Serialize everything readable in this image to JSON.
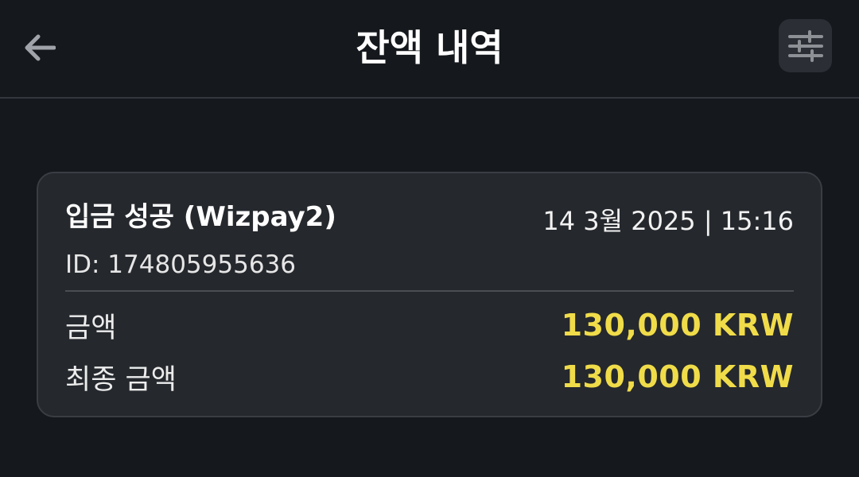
{
  "header": {
    "title": "잔액 내역",
    "back_icon": "arrow-left-icon",
    "filter_icon": "sliders-icon"
  },
  "transaction": {
    "title": "입금 성공 (Wizpay2)",
    "datetime": "14 3월 2025 | 15:16",
    "id_text": "ID: 174805955636",
    "rows": [
      {
        "label": "금액",
        "value": "130,000 KRW"
      },
      {
        "label": "최종 금액",
        "value": "130,000 KRW"
      }
    ]
  },
  "colors": {
    "background": "#15181c",
    "card": "#25282d",
    "amount": "#f0dc49"
  }
}
